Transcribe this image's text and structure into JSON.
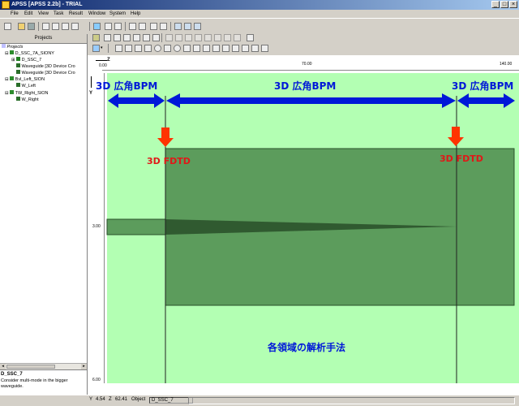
{
  "window": {
    "title": "APSS [APSS 2.2b] - TRIAL"
  },
  "menu": [
    "File",
    "Edit",
    "View",
    "Task",
    "Result",
    "Window",
    "System",
    "Help"
  ],
  "projects_panel": {
    "header": "Projects",
    "root": "Projects",
    "items": [
      {
        "label": "D_SSC_7A_SIONY",
        "level": 1
      },
      {
        "label": "D_SSC_7",
        "level": 2
      },
      {
        "label": "Waveguide [3D Device Cro",
        "level": 2
      },
      {
        "label": "Waveguide [3D Device Cro",
        "level": 2
      },
      {
        "label": "Bvl_Left_SION",
        "level": 1
      },
      {
        "label": "W_Left",
        "level": 2
      },
      {
        "label": "TW_Right_SION",
        "level": 1
      },
      {
        "label": "W_Right",
        "level": 2
      }
    ]
  },
  "description": {
    "title": "D_SSC_7",
    "text": "Consider multi-mode in the bigger waveguide."
  },
  "ruler": {
    "z_label": "Z",
    "y_label": "Y",
    "x_ticks": [
      "0.00",
      "70.00",
      "140.00"
    ],
    "y_ticks": [
      "0.00",
      "3.00",
      "6.00"
    ]
  },
  "annotations": {
    "bpm_left": "3D 広角BPM",
    "bpm_center": "3D 広角BPM",
    "bpm_right": "3D 広角BPM",
    "fdtd_left": "3D  FDTD",
    "fdtd_right": "3D  FDTD",
    "footer": "各領域の解析手法"
  },
  "status": {
    "y_label": "Y",
    "y_value": "4.54",
    "z_label": "Z",
    "z_value": "62.41",
    "object_label": "Object",
    "object_value": "D_SSC_7"
  },
  "colors": {
    "region_bg": "#b3ffb3",
    "device": "#5c9c5c",
    "arrow_blue": "#0018d8",
    "arrow_red": "#ff3300"
  }
}
